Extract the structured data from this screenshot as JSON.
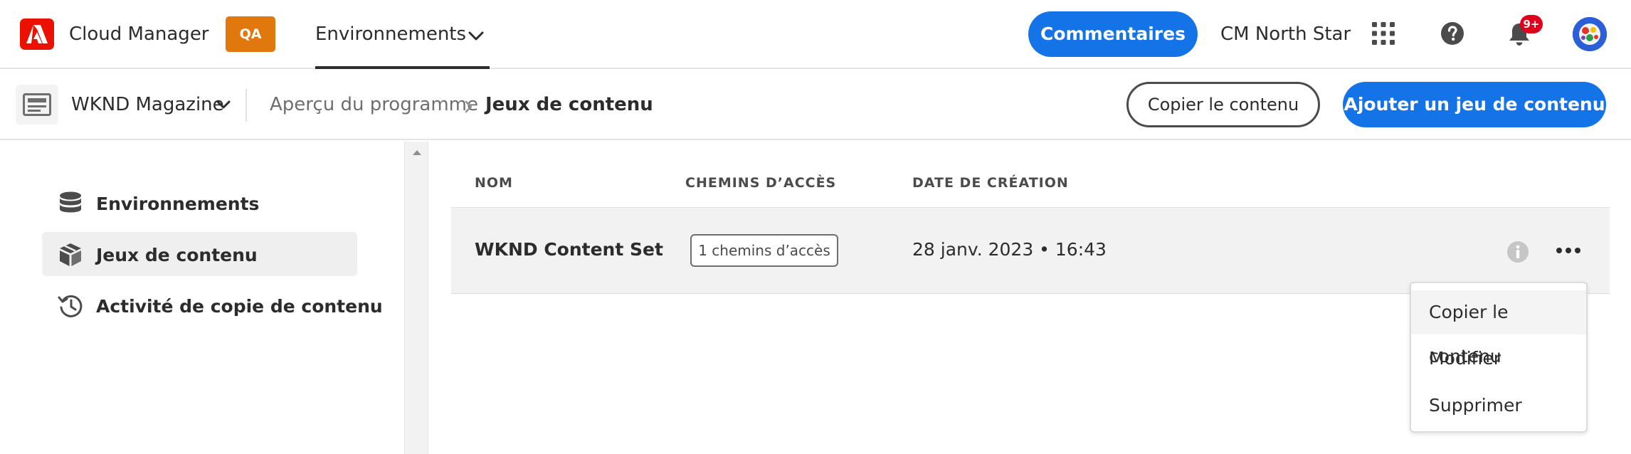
{
  "topbar": {
    "app_name": "Cloud Manager",
    "env_badge": "QA",
    "nav_tab_label": "Environnements",
    "feedback_button": "Commentaires",
    "org_name": "CM North Star",
    "notification_count": "9+",
    "colors": {
      "brand_red": "#eb1000",
      "accent_blue": "#1473e6",
      "badge_orange": "#e1780d"
    }
  },
  "subbar": {
    "program_name": "WKND Magazine",
    "breadcrumb": [
      "Aperçu du programme",
      "Jeux de contenu"
    ],
    "copy_button": "Copier le contenu",
    "add_button": "Ajouter un jeu de contenu"
  },
  "sidebar": {
    "items": [
      {
        "label": "Environnements",
        "icon": "database-icon",
        "active": false
      },
      {
        "label": "Jeux de contenu",
        "icon": "cube-icon",
        "active": true
      },
      {
        "label": "Activité de copie de contenu",
        "icon": "history-icon",
        "active": false
      }
    ]
  },
  "table": {
    "columns": [
      "NOM",
      "CHEMINS D’ACCÈS",
      "DATE DE CRÉATION"
    ],
    "rows": [
      {
        "name": "WKND Content Set",
        "paths": "1 chemins d’accès",
        "created": "28 janv. 2023 • 16:43"
      }
    ]
  },
  "row_menu": {
    "items": [
      "Copier le contenu",
      "Modifier",
      "Supprimer"
    ]
  }
}
